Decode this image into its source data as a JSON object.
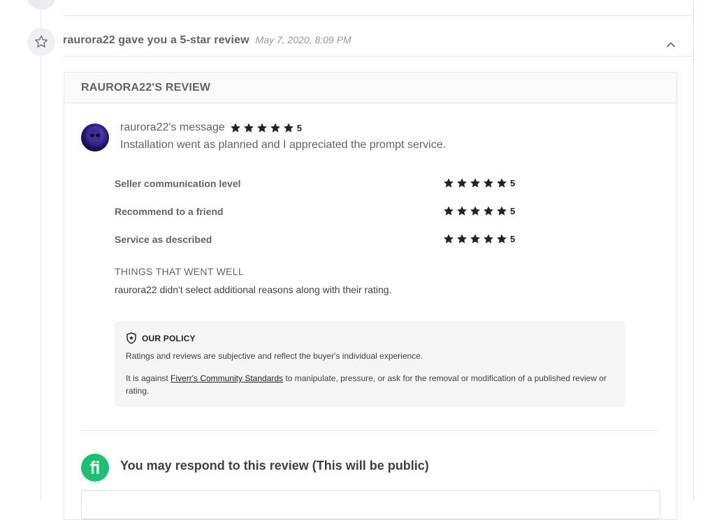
{
  "event": {
    "title": "raurora22 gave you a 5-star review",
    "time": "May 7, 2020, 8:09 PM"
  },
  "card": {
    "title": "RAURORA22'S REVIEW"
  },
  "message": {
    "reviewer_label": "raurora22's message",
    "rating": "5",
    "text": "Installation went as planned and I appreciated the prompt service."
  },
  "criteria": [
    {
      "label": "Seller communication level",
      "rating": "5"
    },
    {
      "label": "Recommend to a friend",
      "rating": "5"
    },
    {
      "label": "Service as described",
      "rating": "5"
    }
  ],
  "went_well": {
    "title": "THINGS THAT WENT WELL",
    "text": "raurora22 didn't select additional reasons along with their rating."
  },
  "policy": {
    "title": "OUR POLICY",
    "line1": "Ratings and reviews are subjective and reflect the buyer's individual experience.",
    "line2_prefix": "It is against",
    "link": "Fiverr's Community Standards",
    "line2_suffix": "to manipulate, pressure, or ask for the removal or modification of a published review or rating."
  },
  "respond": {
    "title": "You may respond to this review (This will be public)"
  },
  "icons": {
    "event": "star-outline-icon",
    "collapse": "chevron-up-icon",
    "policy": "shield-star-icon",
    "logo": "fiverr-logo"
  },
  "colors": {
    "brand_green": "#1dbf73",
    "star": "#222325",
    "text_muted": "#62646a"
  }
}
